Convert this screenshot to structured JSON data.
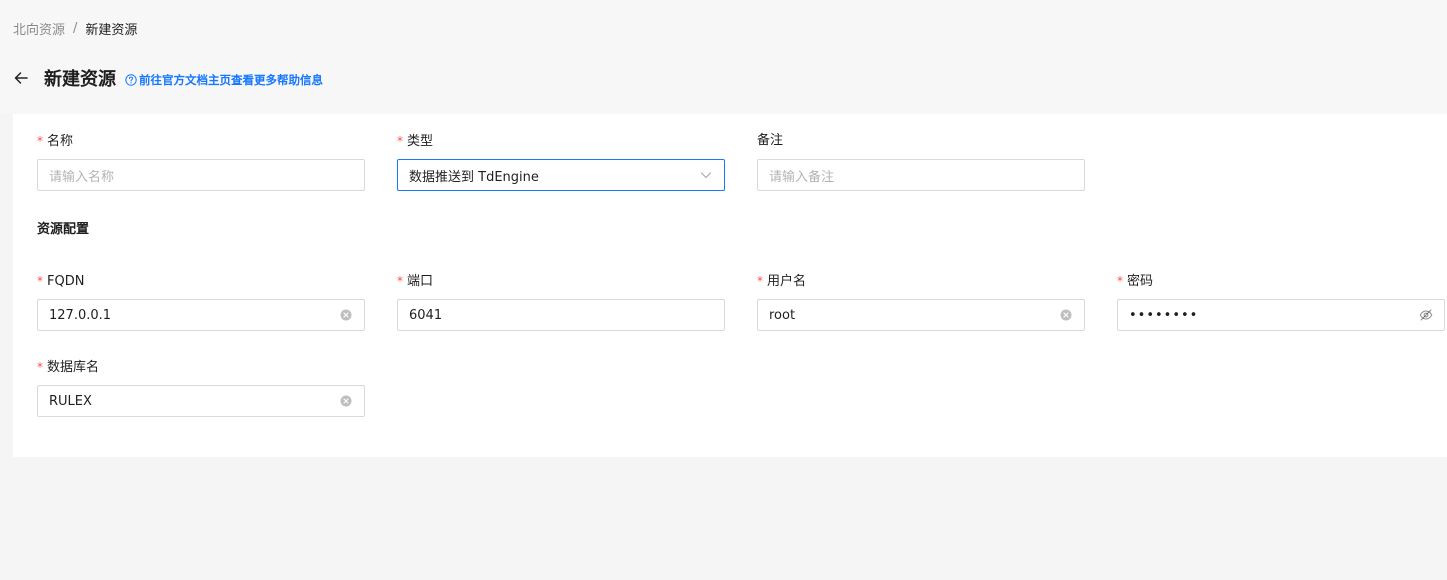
{
  "breadcrumb": {
    "parent": "北向资源",
    "separator": "/",
    "current": "新建资源"
  },
  "header": {
    "title": "新建资源",
    "help_link": "前往官方文档主页查看更多帮助信息"
  },
  "form": {
    "name": {
      "label": "名称",
      "required": true,
      "placeholder": "请输入名称",
      "value": ""
    },
    "type": {
      "label": "类型",
      "required": true,
      "value": "数据推送到 TdEngine"
    },
    "remark": {
      "label": "备注",
      "required": false,
      "placeholder": "请输入备注",
      "value": ""
    },
    "section_title": "资源配置",
    "fqdn": {
      "label": "FQDN",
      "required": true,
      "value": "127.0.0.1"
    },
    "port": {
      "label": "端口",
      "required": true,
      "value": "6041"
    },
    "username": {
      "label": "用户名",
      "required": true,
      "value": "root"
    },
    "password": {
      "label": "密码",
      "required": true,
      "masked_value": "••••••••"
    },
    "dbname": {
      "label": "数据库名",
      "required": true,
      "value": "RULEX"
    }
  },
  "required_mark": "*",
  "colors": {
    "accent": "#1677ff",
    "required": "#ff4d4f",
    "border": "#d9d9d9",
    "background": "#f5f5f5"
  },
  "icons": {
    "back": "arrow-left-icon",
    "help": "question-circle-icon",
    "select": "chevron-down-icon",
    "clear": "close-circle-icon",
    "password_toggle": "eye-invisible-icon"
  }
}
